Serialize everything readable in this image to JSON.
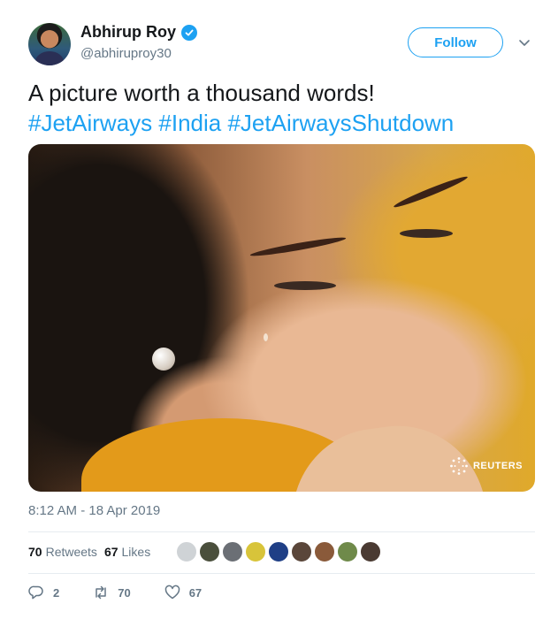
{
  "author": {
    "name": "Abhirup Roy",
    "handle": "@abhiruproy30",
    "verified_icon": "verified-badge-icon",
    "avatar_icon": "profile-avatar"
  },
  "header": {
    "follow_label": "Follow",
    "menu_icon": "chevron-down-icon"
  },
  "tweet": {
    "text": "A picture worth a thousand words!",
    "hashtags": [
      "#JetAirways",
      "#India",
      "#JetAirwaysShutdown"
    ],
    "media_watermark": "REUTERS",
    "timestamp": "8:12 AM - 18 Apr 2019"
  },
  "stats": {
    "retweets_count": "70",
    "retweets_label": "Retweets",
    "likes_count": "67",
    "likes_label": "Likes",
    "liker_avatar_colors": [
      "#cfd3d6",
      "#4a4f3c",
      "#6b6f75",
      "#d8c43a",
      "#1f3f86",
      "#5a463a",
      "#8a5a3a",
      "#6f8a4a",
      "#4a3a32"
    ]
  },
  "actions": {
    "reply_count": "2",
    "retweet_count": "70",
    "like_count": "67"
  },
  "colors": {
    "accent": "#1da1f2",
    "text_primary": "#14171a",
    "text_secondary": "#657786",
    "divider": "#e6ecf0"
  }
}
